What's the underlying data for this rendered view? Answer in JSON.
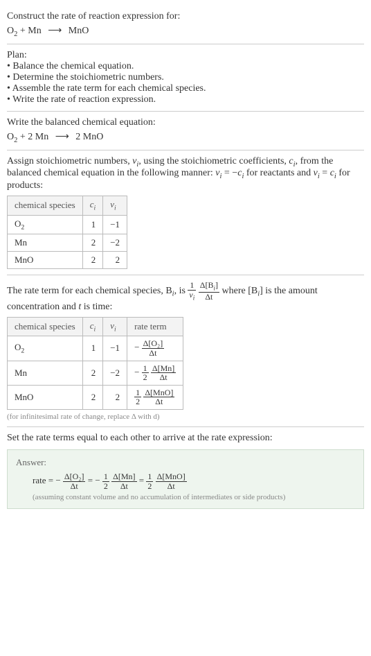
{
  "intro": {
    "prompt": "Construct the rate of reaction expression for:",
    "eq_lhs1": "O",
    "eq_sub1": "2",
    "eq_plus": " + Mn ",
    "eq_arrow": "⟶",
    "eq_rhs": " MnO"
  },
  "plan": {
    "heading": "Plan:",
    "b1": "• Balance the chemical equation.",
    "b2": "• Determine the stoichiometric numbers.",
    "b3": "• Assemble the rate term for each chemical species.",
    "b4": "• Write the rate of reaction expression."
  },
  "balanced": {
    "heading": "Write the balanced chemical equation:",
    "lhs1": "O",
    "sub1": "2",
    "plus": " + 2 Mn ",
    "arrow": "⟶",
    "rhs": " 2 MnO"
  },
  "stoich": {
    "desc1": "Assign stoichiometric numbers, ",
    "nu": "ν",
    "sub_i": "i",
    "desc2": ", using the stoichiometric coefficients, ",
    "c": "c",
    "desc3": ", from the balanced chemical equation in the following manner: ",
    "eq_react": " = −",
    "desc4": " for reactants and ",
    "eq_prod": " = ",
    "desc5": " for products:",
    "table": {
      "h_species": "chemical species",
      "h_ci": "c",
      "h_nui": "ν",
      "rows": [
        {
          "species_a": "O",
          "species_sub": "2",
          "species_b": "",
          "ci": "1",
          "nui": "−1"
        },
        {
          "species_a": "Mn",
          "species_sub": "",
          "species_b": "",
          "ci": "2",
          "nui": "−2"
        },
        {
          "species_a": "MnO",
          "species_sub": "",
          "species_b": "",
          "ci": "2",
          "nui": "2"
        }
      ]
    }
  },
  "rateterm": {
    "desc_a": "The rate term for each chemical species, B",
    "desc_b": ", is ",
    "frac1_num": "1",
    "frac1_den_a": "ν",
    "frac2_num_a": "Δ[B",
    "frac2_num_b": "]",
    "frac2_den": "Δt",
    "desc_c": " where [B",
    "desc_d": "] is the amount concentration and ",
    "t": "t",
    "desc_e": " is time:",
    "table": {
      "h_species": "chemical species",
      "h_ci": "c",
      "h_nui": "ν",
      "h_rate": "rate term",
      "rows": [
        {
          "species_a": "O",
          "species_sub": "2",
          "ci": "1",
          "nui": "−1",
          "rt_prefix": "−",
          "rt_coef_num": "",
          "rt_coef_den": "",
          "rt_num": "Δ[O₂]",
          "rt_den": "Δt"
        },
        {
          "species_a": "Mn",
          "species_sub": "",
          "ci": "2",
          "nui": "−2",
          "rt_prefix": "−",
          "rt_coef_num": "1",
          "rt_coef_den": "2",
          "rt_num": "Δ[Mn]",
          "rt_den": "Δt"
        },
        {
          "species_a": "MnO",
          "species_sub": "",
          "ci": "2",
          "nui": "2",
          "rt_prefix": "",
          "rt_coef_num": "1",
          "rt_coef_den": "2",
          "rt_num": "Δ[MnO]",
          "rt_den": "Δt"
        }
      ]
    },
    "caption": "(for infinitesimal rate of change, replace Δ with d)"
  },
  "final": {
    "heading": "Set the rate terms equal to each other to arrive at the rate expression:"
  },
  "answer": {
    "title": "Answer:",
    "rate_label": "rate = ",
    "t1_prefix": "−",
    "t1_num": "Δ[O₂]",
    "t1_den": "Δt",
    "eq1": " = ",
    "t2_prefix": "−",
    "t2_cnum": "1",
    "t2_cden": "2",
    "t2_num": "Δ[Mn]",
    "t2_den": "Δt",
    "eq2": " = ",
    "t3_cnum": "1",
    "t3_cden": "2",
    "t3_num": "Δ[MnO]",
    "t3_den": "Δt",
    "assume": "(assuming constant volume and no accumulation of intermediates or side products)"
  },
  "chart_data": {
    "type": "table",
    "title": "Stoichiometric numbers and rate terms",
    "tables": [
      {
        "columns": [
          "chemical species",
          "c_i",
          "ν_i"
        ],
        "rows": [
          [
            "O2",
            1,
            -1
          ],
          [
            "Mn",
            2,
            -2
          ],
          [
            "MnO",
            2,
            2
          ]
        ]
      },
      {
        "columns": [
          "chemical species",
          "c_i",
          "ν_i",
          "rate term"
        ],
        "rows": [
          [
            "O2",
            1,
            -1,
            "-Δ[O2]/Δt"
          ],
          [
            "Mn",
            2,
            -2,
            "-(1/2)Δ[Mn]/Δt"
          ],
          [
            "MnO",
            2,
            2,
            "(1/2)Δ[MnO]/Δt"
          ]
        ]
      }
    ],
    "rate_expression": "rate = -Δ[O2]/Δt = -(1/2)Δ[Mn]/Δt = (1/2)Δ[MnO]/Δt"
  }
}
